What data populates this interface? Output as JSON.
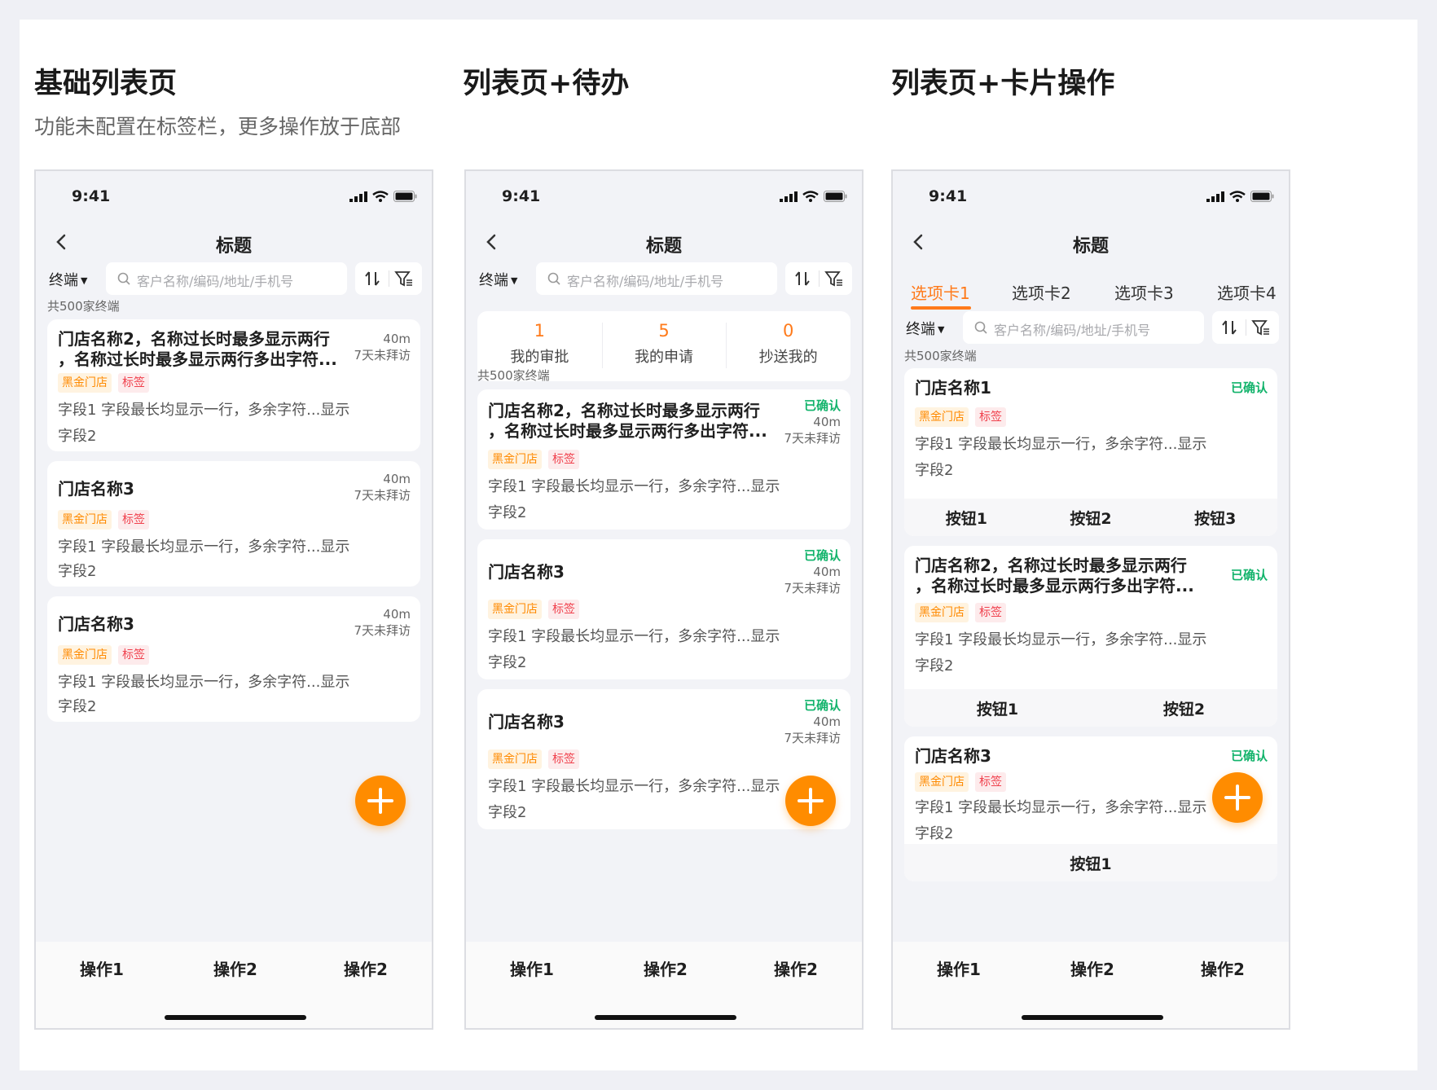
{
  "sections": [
    {
      "title": "基础列表页",
      "subtitle": "功能未配置在标签栏，更多操作放于底部"
    },
    {
      "title": "列表页+待办"
    },
    {
      "title": "列表页+卡片操作"
    }
  ],
  "common": {
    "time": "9:41",
    "nav_title": "标题",
    "terminal_label": "终端",
    "search_placeholder": "客户名称/编码/地址/手机号",
    "count_text": "共500家终端",
    "tag_gold": "黑金门店",
    "tag_red": "标签",
    "field1": "字段1 字段最长均显示一行，多余字符...显示",
    "field2": "字段2",
    "distance": "40m",
    "visit": "7天未拜访",
    "confirmed": "已确认",
    "store_long_1": "门店名称2，名称过长时最多显示两行",
    "store_long_2": "，名称过长时最多显示两行多出字符...",
    "store3": "门店名称3",
    "store1": "门店名称1",
    "actions": [
      "操作1",
      "操作2",
      "操作2"
    ]
  },
  "todo": [
    {
      "num": "1",
      "label": "我的审批"
    },
    {
      "num": "5",
      "label": "我的申请"
    },
    {
      "num": "0",
      "label": "抄送我的"
    }
  ],
  "tabs": [
    "选项卡1",
    "选项卡2",
    "选项卡3",
    "选项卡4"
  ],
  "buttons": {
    "b1": "按钮1",
    "b2": "按钮2",
    "b3": "按钮3"
  },
  "colors": {
    "accent": "#ff7a1a",
    "fab": "#ff8c00",
    "confirmed": "#12b36b"
  }
}
